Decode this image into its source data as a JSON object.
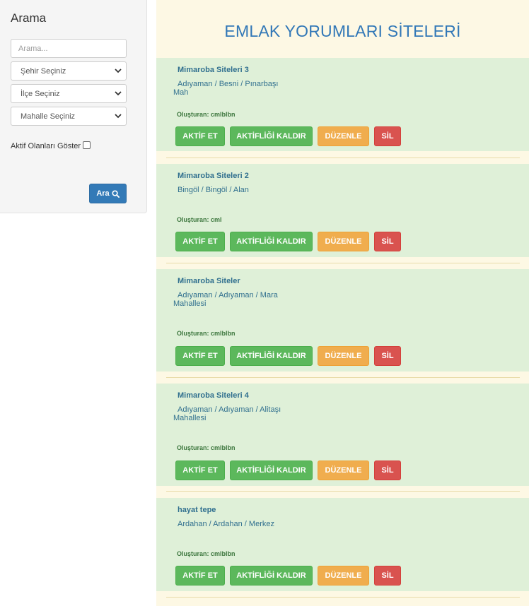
{
  "sidebar": {
    "title": "Arama",
    "search_placeholder": "Arama...",
    "city_select": "Şehir Seçiniz",
    "district_select": "İlçe Seçiniz",
    "neighborhood_select": "Mahalle Seçiniz",
    "active_checkbox_label": "Aktif Olanları Göster",
    "search_button": "Ara"
  },
  "main": {
    "title": "EMLAK YORUMLARI SİTELERİ",
    "buttons": {
      "activate": "AKTİF ET",
      "deactivate": "AKTİFLİĞİ KALDIR",
      "edit": "DÜZENLE",
      "delete": "SİL"
    },
    "cards": [
      {
        "name": "Mimaroba Siteleri 3",
        "location": "Adıyaman / Besni / Pınarbaşı Mah",
        "creator": "Oluşturan: cmlblbn"
      },
      {
        "name": "Mimaroba Siteleri 2",
        "location": "Bingöl / Bingöl / Alan",
        "creator": "Oluşturan: cml"
      },
      {
        "name": "Mimaroba Siteler",
        "location": "Adıyaman / Adıyaman / Mara Mahallesi",
        "creator": "Oluşturan: cmlblbn"
      },
      {
        "name": "Mimaroba Siteleri 4",
        "location": "Adıyaman / Adıyaman / Alitaşı Mahallesi",
        "creator": "Oluşturan: cmlblbn"
      },
      {
        "name": "hayat tepe",
        "location": "Ardahan / Ardahan / Merkez",
        "creator": "Oluşturan: cmlblbn"
      }
    ]
  }
}
